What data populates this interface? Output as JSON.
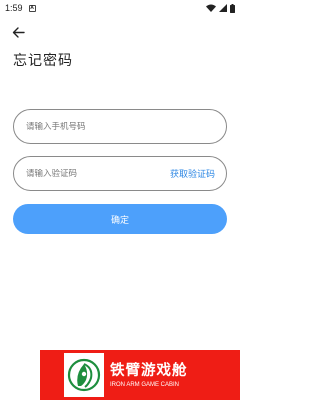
{
  "status_bar": {
    "time": "1:59",
    "notification_glyph": "A"
  },
  "header": {
    "back_icon": "arrow-left-icon",
    "title": "忘记密码"
  },
  "form": {
    "phone_placeholder": "请输入手机号码",
    "phone_value": "",
    "code_placeholder": "请输入验证码",
    "code_value": "",
    "get_code_label": "获取验证码",
    "confirm_label": "确定"
  },
  "ad": {
    "title": "铁臂游戏舱",
    "subtitle": "IRON ARM GAME CABIN"
  },
  "colors": {
    "accent_blue": "#4da0fb",
    "link_blue": "#2f88e4",
    "ad_red": "#ef1d15",
    "logo_green": "#1e8e3e"
  }
}
